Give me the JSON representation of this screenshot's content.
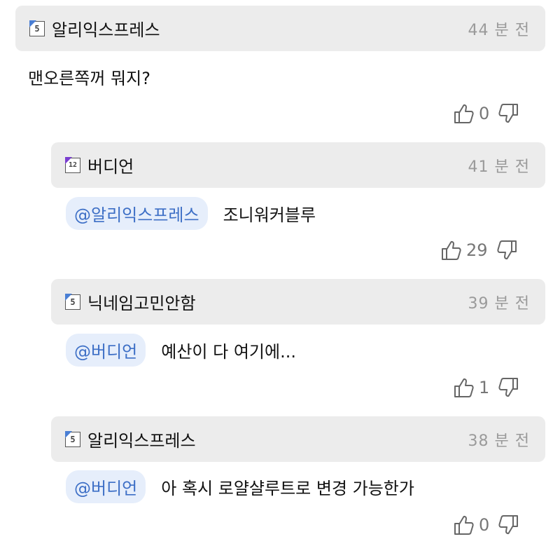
{
  "comments": [
    {
      "user": "알리익스프레스",
      "badge": "5",
      "badge_color": "#4a7fd4",
      "time": "44 분 전",
      "mention": "",
      "text": "맨오른쪽꺼 뭐지?",
      "likes": "0"
    },
    {
      "user": "버디언",
      "badge": "12",
      "badge_color": "#7a3fd0",
      "time": "41 분 전",
      "mention": "@알리익스프레스",
      "text": "조니워커블루",
      "likes": "29"
    },
    {
      "user": "닉네임고민안함",
      "badge": "5",
      "badge_color": "#4a7fd4",
      "time": "39 분 전",
      "mention": "@버디언",
      "text": "예산이 다 여기에...",
      "likes": "1"
    },
    {
      "user": "알리익스프레스",
      "badge": "5",
      "badge_color": "#4a7fd4",
      "time": "38 분 전",
      "mention": "@버디언",
      "text": "아 혹시 로얄샬루트로 변경 가능한가",
      "likes": "0"
    }
  ]
}
